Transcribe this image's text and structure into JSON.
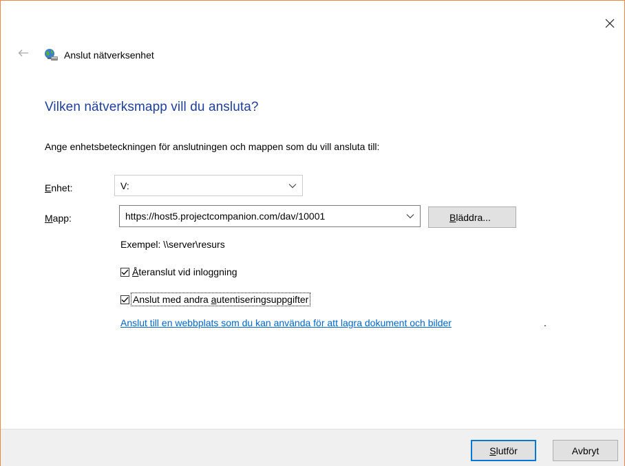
{
  "window": {
    "title": "Anslut nätverksenhet",
    "close_label": "×"
  },
  "nav": {
    "back_glyph": "←"
  },
  "page": {
    "heading": "Vilken nätverksmapp vill du ansluta?",
    "instruction": "Ange enhetsbeteckningen för anslutningen och mappen som du vill ansluta till:"
  },
  "drive": {
    "label_accel": "E",
    "label_rest": "nhet:",
    "value": "V:"
  },
  "folder": {
    "label_accel": "M",
    "label_rest": "app:",
    "value": "https://host5.projectcompanion.com/dav/10001",
    "browse_accel": "B",
    "browse_rest": "läddra..."
  },
  "example": "Exempel: \\\\server\\resurs",
  "options": {
    "reconnect_accel": "Å",
    "reconnect_rest": "teranslut vid inloggning",
    "reconnect_checked": true,
    "other_creds_pre": "Anslut med andra ",
    "other_creds_accel": "a",
    "other_creds_rest": "utentiseringsuppgifter",
    "other_creds_checked": true
  },
  "link": {
    "text": "Anslut till en webbplats som du kan använda för att lagra dokument och bilder",
    "trailing": "."
  },
  "footer": {
    "finish_accel": "S",
    "finish_rest": "lutför",
    "cancel": "Avbryt"
  },
  "colors": {
    "heading": "#1e3e9c",
    "link": "#0066cc",
    "window_border": "#e8894a",
    "primary_border": "#0078d7"
  },
  "icons": {
    "network_drive": "network-drive-icon",
    "back": "arrow-left-icon",
    "close": "close-icon",
    "dropdown": "chevron-down-icon",
    "check": "checkmark-icon"
  }
}
